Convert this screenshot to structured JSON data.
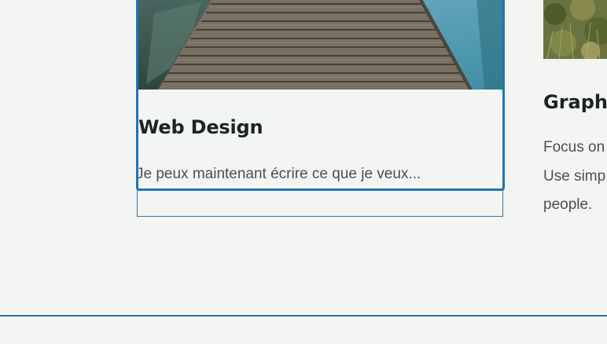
{
  "cards": [
    {
      "title": "Web Design",
      "excerpt": "Je peux maintenant écrire ce que je veux...",
      "image": "boardwalk-over-water-image"
    },
    {
      "title": "Graphi",
      "text_lines": [
        "Focus on",
        "Use simp",
        "people."
      ],
      "image": "grass-field-image"
    }
  ],
  "colors": {
    "background": "#f3f5f2",
    "accent": "#1f74b8",
    "title": "#1b2424",
    "body_text": "#4a4e4e"
  }
}
